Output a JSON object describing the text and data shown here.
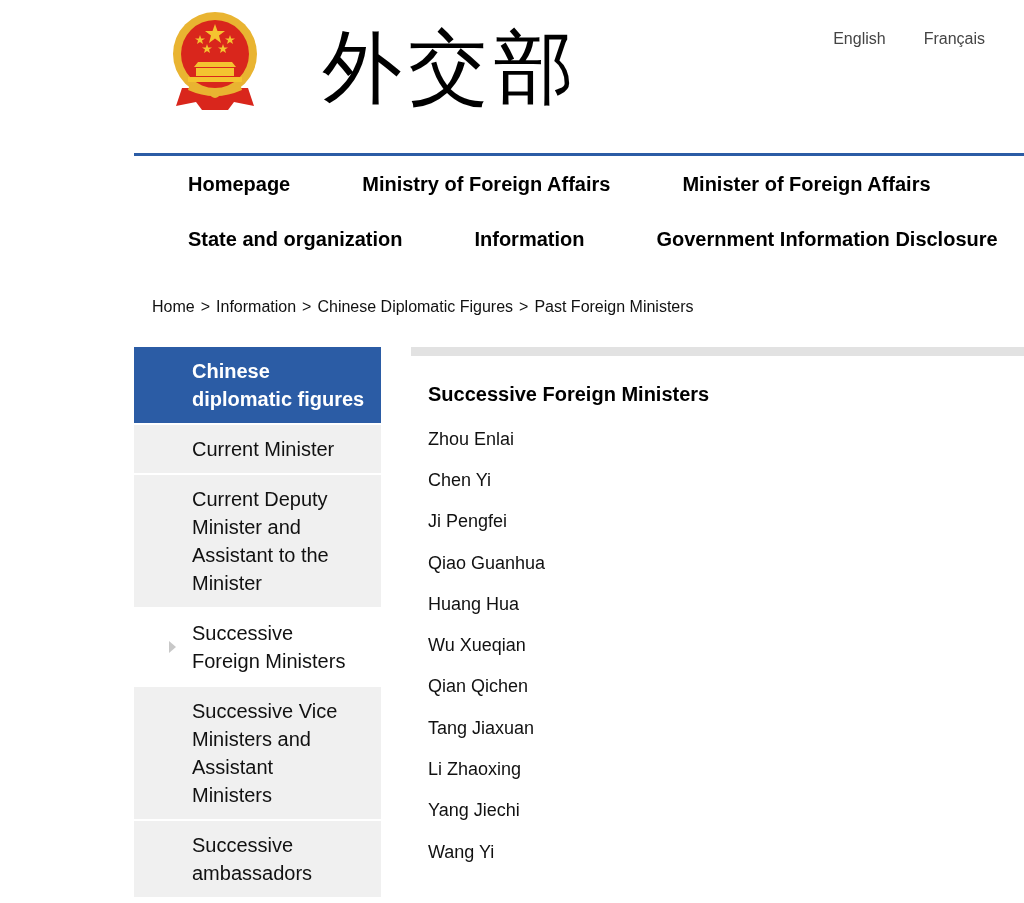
{
  "header": {
    "logo_text": "外交部",
    "languages": [
      "English",
      "Français"
    ]
  },
  "nav_rows": [
    {
      "items": [
        "Homepage",
        "Ministry of Foreign Affairs",
        "Minister of Foreign Affairs"
      ]
    },
    {
      "items": [
        "State and organization",
        "Information",
        "Government Information Disclosure"
      ]
    }
  ],
  "breadcrumb": [
    {
      "kind": "link",
      "text": "Home"
    },
    {
      "kind": "separator",
      "text": ">"
    },
    {
      "kind": "link",
      "text": "Information"
    },
    {
      "kind": "separator",
      "text": ">"
    },
    {
      "kind": "link",
      "text": "Chinese Diplomatic Figures"
    },
    {
      "kind": "separator",
      "text": ">"
    },
    {
      "kind": "link",
      "text": "Past Foreign Ministers"
    }
  ],
  "sidebar": {
    "items": [
      {
        "kind": "header",
        "label": "Chinese diplomatic figures",
        "selected": false
      },
      {
        "kind": "link",
        "label": "Current Minister",
        "selected": false
      },
      {
        "kind": "link",
        "label": "Current Deputy Minister and Assistant to the Minister",
        "selected": false
      },
      {
        "kind": "link",
        "label": "Successive Foreign Ministers",
        "selected": true
      },
      {
        "kind": "link",
        "label": "Successive Vice Ministers and Assistant Ministers",
        "selected": false
      },
      {
        "kind": "link",
        "label": "Successive ambassadors",
        "selected": false
      }
    ]
  },
  "content": {
    "title": "Successive Foreign Ministers",
    "names": [
      "Zhou Enlai",
      "Chen Yi",
      "Ji Pengfei",
      "Qiao Guanhua",
      "Huang Hua",
      "Wu Xueqian",
      "Qian Qichen",
      "Tang Jiaxuan",
      "Li Zhaoxing",
      "Yang Jiechi",
      "Wang Yi"
    ]
  }
}
